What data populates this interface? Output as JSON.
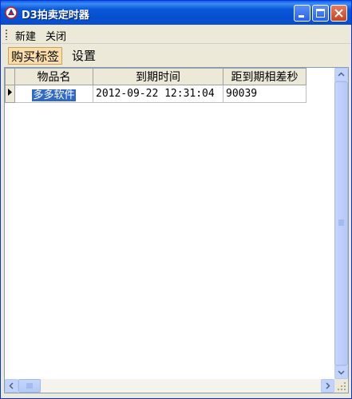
{
  "window": {
    "title": "D3拍卖定时器"
  },
  "menubar": {
    "new_label": "新建",
    "close_label": "关闭"
  },
  "tabs": [
    {
      "label": "购买标签",
      "active": true
    },
    {
      "label": "设置",
      "active": false
    }
  ],
  "table": {
    "columns": [
      "物品名",
      "到期时间",
      "距到期相差秒"
    ],
    "rows": [
      {
        "item": "多多软件",
        "expiry": "2012-09-22 12:31:04",
        "seconds": "90039",
        "selected": true
      }
    ]
  },
  "colors": {
    "titlebar": "#0A5FE8",
    "selection": "#316AC5",
    "active_tab": "#FCDFA8"
  }
}
